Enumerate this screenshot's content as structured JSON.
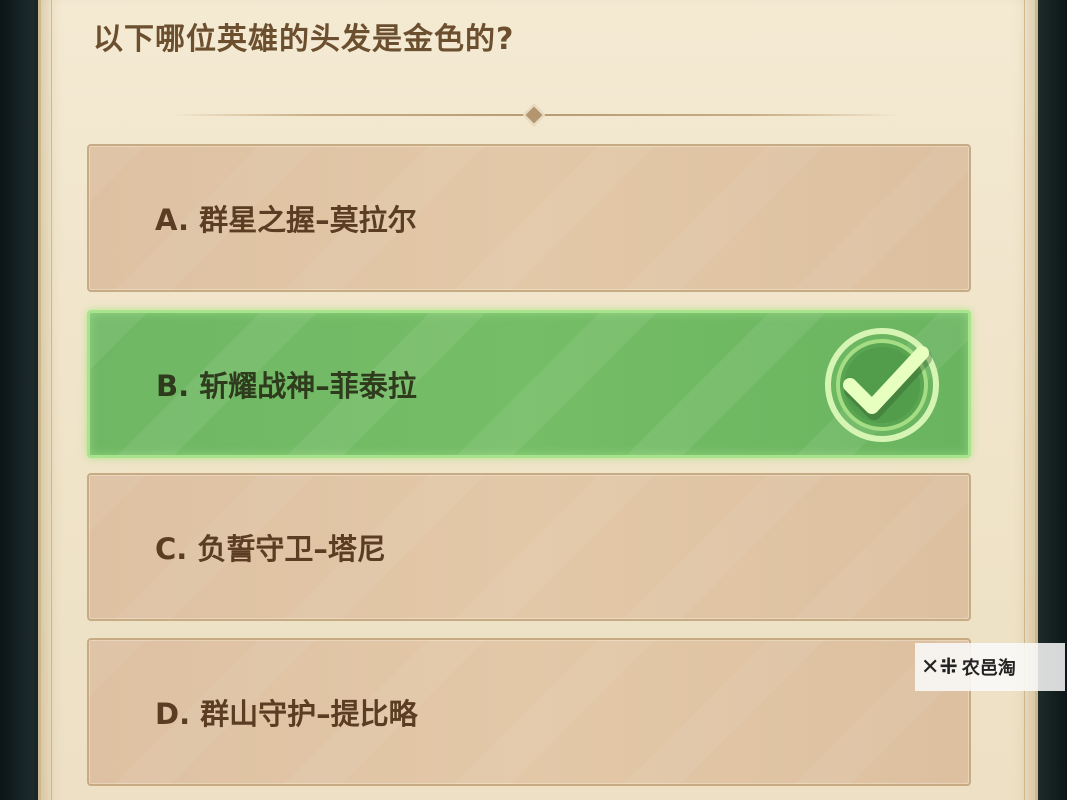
{
  "quiz": {
    "question": "以下哪位英雄的头发是金色的?",
    "options": [
      {
        "label": "A. 群星之握–莫拉尔",
        "state": "normal"
      },
      {
        "label": "B. 斩耀战神–菲泰拉",
        "state": "correct"
      },
      {
        "label": "C. 负誓守卫–塔尼",
        "state": "normal"
      },
      {
        "label": "D. 群山守护–提比略",
        "state": "normal"
      }
    ],
    "correct_icon": "checkmark-icon"
  },
  "watermark": {
    "symbol": "✕⁜",
    "text": "农邑淘"
  },
  "colors": {
    "panel": "#f0e4ca",
    "option": "#e0c5a5",
    "correct": "#72ba64",
    "question_text": "#6b4f2e"
  }
}
